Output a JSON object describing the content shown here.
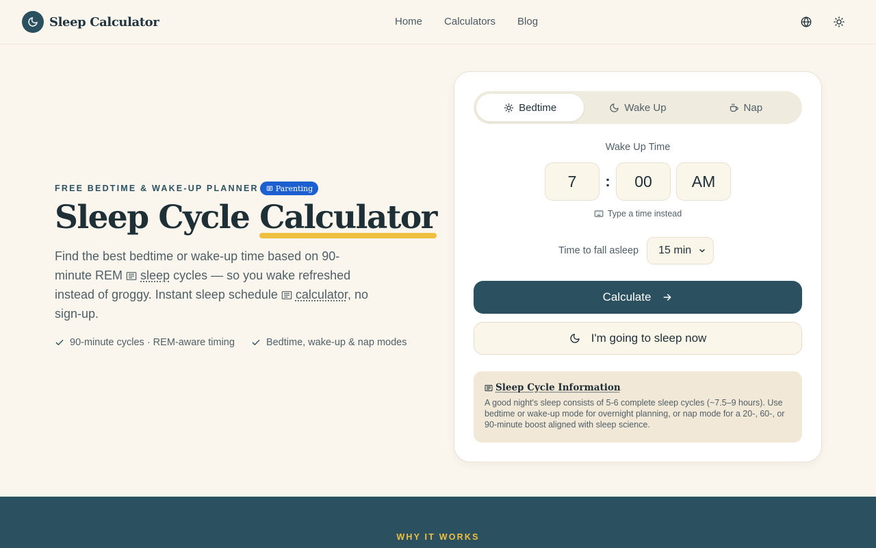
{
  "header": {
    "brand": "Sleep Calculator",
    "nav": [
      "Home",
      "Calculators",
      "Blog"
    ],
    "icons": [
      "globe-icon",
      "sun-icon"
    ]
  },
  "hero": {
    "eyebrow": "FREE BEDTIME & WAKE-UP PLANNER",
    "badge": "Parenting",
    "title_plain": "Sleep Cycle ",
    "title_highlight": "Calculator",
    "desc_1": "Find the best bedtime or wake-up time based on 90-minute REM ",
    "desc_link1": "sleep",
    "desc_2": " cycles — so you wake refreshed instead of groggy. Instant sleep schedule ",
    "desc_link2": "calculator",
    "desc_3": ", no sign-up.",
    "checks": [
      "90-minute cycles · REM-aware timing",
      "Bedtime, wake-up & nap modes"
    ]
  },
  "calculator": {
    "tabs": [
      "Bedtime",
      "Wake Up",
      "Nap"
    ],
    "active_tab": "Bedtime",
    "time_label": "Wake Up Time",
    "hour": "7",
    "minute": "00",
    "period": "AM",
    "type_link": "Type a time instead",
    "fall_label": "Time to fall asleep",
    "fall_value": "15 min",
    "calculate_label": "Calculate",
    "sleep_now_label": "I'm going to sleep now",
    "info_title": "Sleep Cycle Information",
    "info_body": "A good night's sleep consists of 5-6 complete sleep cycles (~7.5–9 hours). Use bedtime or wake-up mode for overnight planning, or nap mode for a 20-, 60-, or 90-minute boost aligned with sleep science."
  },
  "band": {
    "label": "WHY IT WORKS"
  },
  "colors": {
    "primary": "#2b5160",
    "accent": "#efbf3f",
    "background": "#faf6ee",
    "badge": "#1b5fd0"
  }
}
